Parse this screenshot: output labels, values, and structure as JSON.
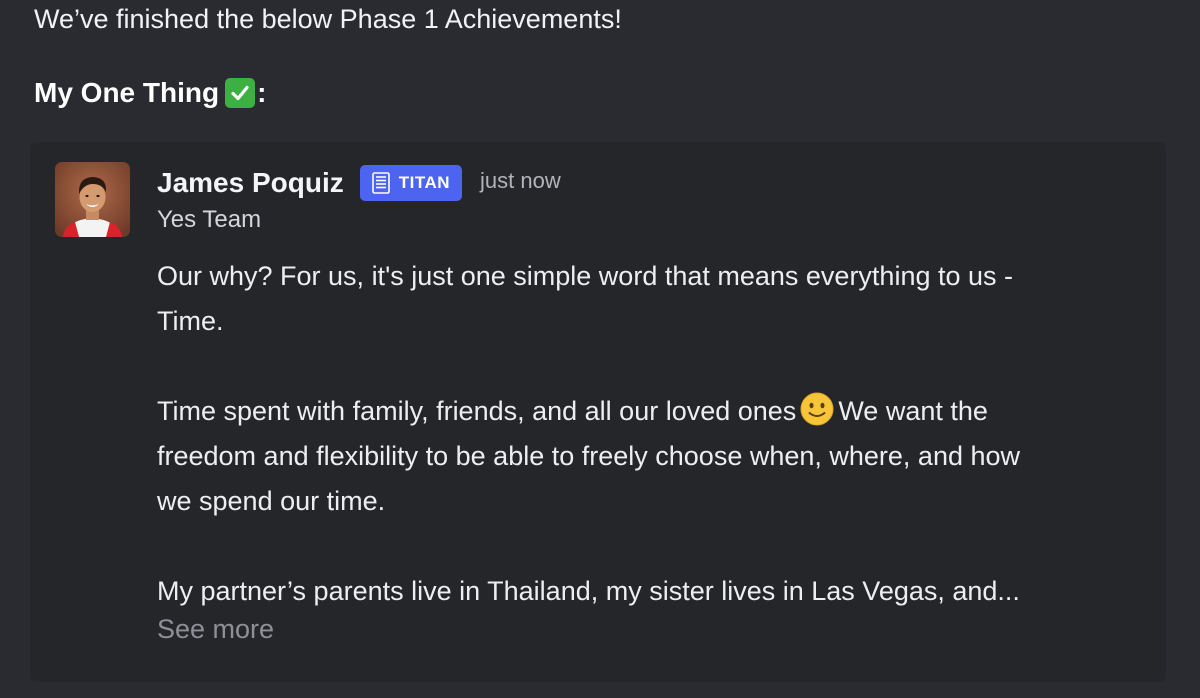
{
  "intro": "We’ve finished the below Phase 1 Achievements!",
  "heading": {
    "label": "My One Thing",
    "icon": "check-mark-button-icon",
    "suffix": ":"
  },
  "post": {
    "author": "James Poquiz",
    "badge": "TITAN",
    "badge_icon": "document-lines-icon",
    "timestamp": "just now",
    "team": "Yes Team",
    "paragraphs": {
      "p1_line1": "Our why? For us, it's just one simple word that means everything to us -",
      "p1_line2": "Time.",
      "p2_line1a": "Time spent with family, friends, and all our loved ones",
      "p2_line1b": "We want the",
      "p2_emoji": "slightly-smiling-face-icon",
      "p2_line2": "freedom and flexibility to be able to freely choose when, where, and how",
      "p2_line3": "we spend our time.",
      "p3_line1": "My partner’s parents live in Thailand, my sister lives in Las Vegas, and..."
    },
    "see_more": "See more"
  },
  "colors": {
    "background": "#2a2b30",
    "card": "#25262a",
    "badge": "#4d64f0",
    "check": "#3cb043",
    "muted": "#8e9097"
  }
}
